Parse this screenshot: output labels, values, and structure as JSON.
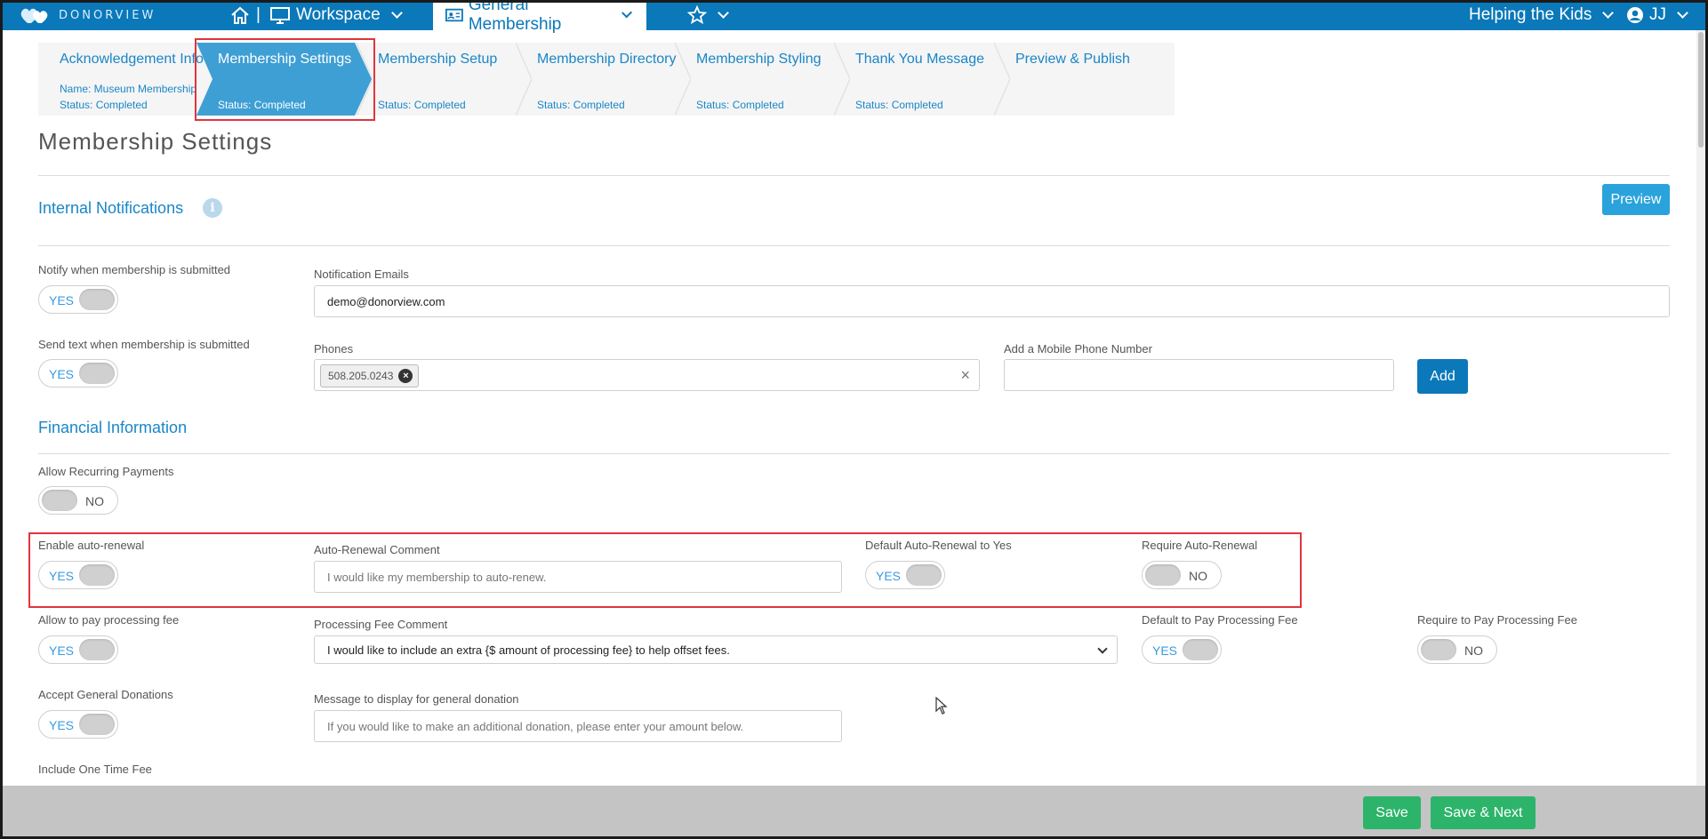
{
  "nav": {
    "logo": "DONORVIEW",
    "home_sep": "|",
    "workspace": "Workspace",
    "current_form": "General Membership",
    "org": "Helping the Kids",
    "user_initials": "JJ"
  },
  "steps": [
    {
      "title": "Acknowledgement Info",
      "name": "Name: Museum Membership",
      "status": "Status: Completed"
    },
    {
      "title": "Membership Settings",
      "status": "Status: Completed"
    },
    {
      "title": "Membership Setup",
      "status": "Status: Completed"
    },
    {
      "title": "Membership Directory",
      "status": "Status: Completed"
    },
    {
      "title": "Membership Styling",
      "status": "Status: Completed"
    },
    {
      "title": "Thank You Message",
      "status": "Status: Completed"
    },
    {
      "title": "Preview & Publish"
    }
  ],
  "page_title": "Membership Settings",
  "preview_button": "Preview",
  "internal_notifications": {
    "title": "Internal Notifications",
    "info_icon": "i",
    "notify_label": "Notify when membership is submitted",
    "notify_value": "YES",
    "emails_label": "Notification Emails",
    "emails_value": "demo@donorview.com",
    "text_label": "Send text when membership is submitted",
    "text_value": "YES",
    "phones_label": "Phones",
    "phone_chip": "508.205.0243",
    "phone_chip_remove": "×",
    "phones_clear": "×",
    "mobile_label": "Add a Mobile Phone Number",
    "mobile_value": "",
    "add_button": "Add"
  },
  "financial": {
    "title": "Financial Information",
    "recurring_label": "Allow Recurring Payments",
    "recurring_value": "NO",
    "autorenew_label": "Enable auto-renewal",
    "autorenew_value": "YES",
    "autorenew_comment_label": "Auto-Renewal Comment",
    "autorenew_comment_placeholder": "I would like my membership to auto-renew.",
    "default_autorenew_label": "Default Auto-Renewal to Yes",
    "default_autorenew_value": "YES",
    "require_autorenew_label": "Require Auto-Renewal",
    "require_autorenew_value": "NO",
    "fee_label": "Allow to pay processing fee",
    "fee_value": "YES",
    "fee_comment_label": "Processing Fee Comment",
    "fee_comment_selected": "I would like to include an extra {$ amount of processing fee} to help offset fees.",
    "default_fee_label": "Default to Pay Processing Fee",
    "default_fee_value": "YES",
    "require_fee_label": "Require to Pay Processing Fee",
    "require_fee_value": "NO",
    "donations_label": "Accept General Donations",
    "donations_value": "YES",
    "donation_msg_label": "Message to display for general donation",
    "donation_msg_placeholder": "If you would like to make an additional donation, please enter your amount below.",
    "one_time_fee_label": "Include One Time Fee"
  },
  "footer": {
    "save": "Save",
    "save_next": "Save & Next"
  },
  "colors": {
    "nav_blue": "#0a78b9",
    "link_blue": "#1a86c7",
    "active_step": "#3e9fd4",
    "save_green": "#2db46b",
    "highlight_red": "#e2343d"
  }
}
